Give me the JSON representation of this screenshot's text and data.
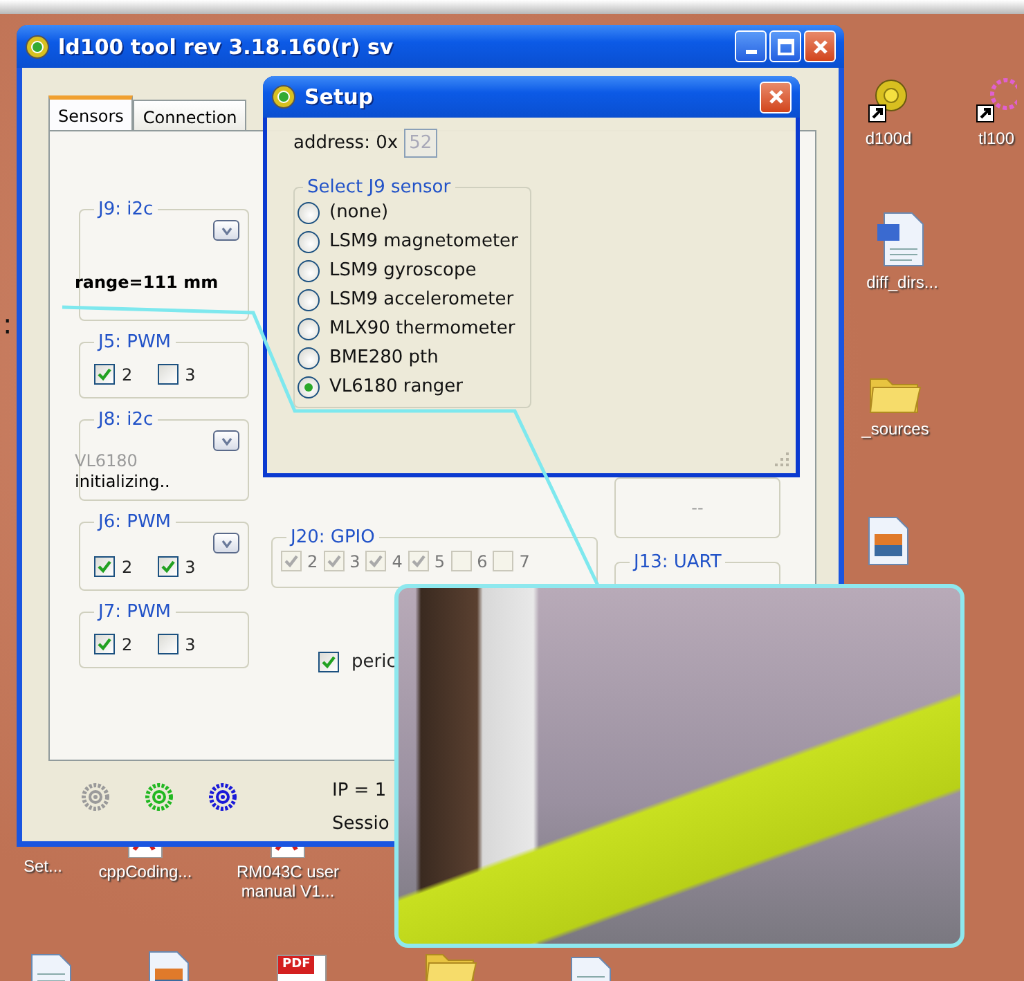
{
  "desktop": {
    "edge_text": ":",
    "icons": [
      {
        "kind": "shortcut",
        "label": "d100d"
      },
      {
        "kind": "shortcut_pink",
        "label": "tl100"
      },
      {
        "kind": "word",
        "label": "diff_dirs..."
      },
      {
        "kind": "folder",
        "label": "_sources"
      },
      {
        "kind": "image"
      },
      {
        "kind": "label_only",
        "label": "Set..."
      },
      {
        "kind": "pdf",
        "label": "cppCoding..."
      },
      {
        "kind": "pdf",
        "label": "RM043C user manual V1..."
      },
      {
        "kind": "doc"
      },
      {
        "kind": "image"
      },
      {
        "kind": "pdf_big",
        "badge": "PDF"
      },
      {
        "kind": "folder"
      },
      {
        "kind": "doc"
      }
    ]
  },
  "main_window": {
    "title": "ld100 tool rev 3.18.160(r)  sv",
    "tabs": [
      {
        "label": "Sensors",
        "selected": true
      },
      {
        "label": "Connection",
        "selected": false
      }
    ],
    "left_groups": [
      {
        "title": "J9: i2c",
        "dropdown": true,
        "readings": [
          {
            "text": "range=111 mm",
            "bold": true,
            "greyed": false
          }
        ]
      },
      {
        "title": "J5: PWM",
        "dropdown": false,
        "channels": [
          {
            "label": "2",
            "checked": true
          },
          {
            "label": "3",
            "checked": false
          }
        ]
      },
      {
        "title": "J8: i2c",
        "dropdown": true,
        "readings": [
          {
            "text": "VL6180",
            "bold": false,
            "greyed": true
          },
          {
            "text": "initializing..",
            "bold": false,
            "greyed": false
          }
        ]
      },
      {
        "title": "J6: PWM",
        "dropdown": true,
        "channels": [
          {
            "label": "2",
            "checked": true
          },
          {
            "label": "3",
            "checked": true
          }
        ]
      },
      {
        "title": "J7: PWM",
        "dropdown": false,
        "channels": [
          {
            "label": "2",
            "checked": true
          },
          {
            "label": "3",
            "checked": false
          }
        ]
      }
    ],
    "gpio": {
      "title": "J20: GPIO",
      "disabled": true,
      "pins": [
        {
          "label": "2",
          "checked": true
        },
        {
          "label": "3",
          "checked": true
        },
        {
          "label": "4",
          "checked": true
        },
        {
          "label": "5",
          "checked": true
        },
        {
          "label": "6",
          "checked": false
        },
        {
          "label": "7",
          "checked": false
        }
      ]
    },
    "periodic": {
      "label": "peric",
      "checked": true
    },
    "uart_box": {
      "text": "--"
    },
    "uart_group": {
      "title": "J13: UART"
    },
    "status_icons": [
      {
        "color": "#9a9a9a"
      },
      {
        "color": "#22b822"
      },
      {
        "color": "#1a1ad8"
      }
    ],
    "status_lines": [
      "IP = 1",
      "Sessio"
    ]
  },
  "setup_dialog": {
    "title": "Setup",
    "address_label": "address: 0x",
    "address_value": "52",
    "group_title": "Select J9 sensor",
    "options": [
      {
        "label": "(none)",
        "selected": false
      },
      {
        "label": "LSM9 magnetometer",
        "selected": false
      },
      {
        "label": "LSM9 gyroscope",
        "selected": false
      },
      {
        "label": "LSM9 accelerometer",
        "selected": false
      },
      {
        "label": "MLX90 thermometer",
        "selected": false
      },
      {
        "label": "BME280 pth",
        "selected": false
      },
      {
        "label": "VL6180 ranger",
        "selected": true
      }
    ]
  }
}
